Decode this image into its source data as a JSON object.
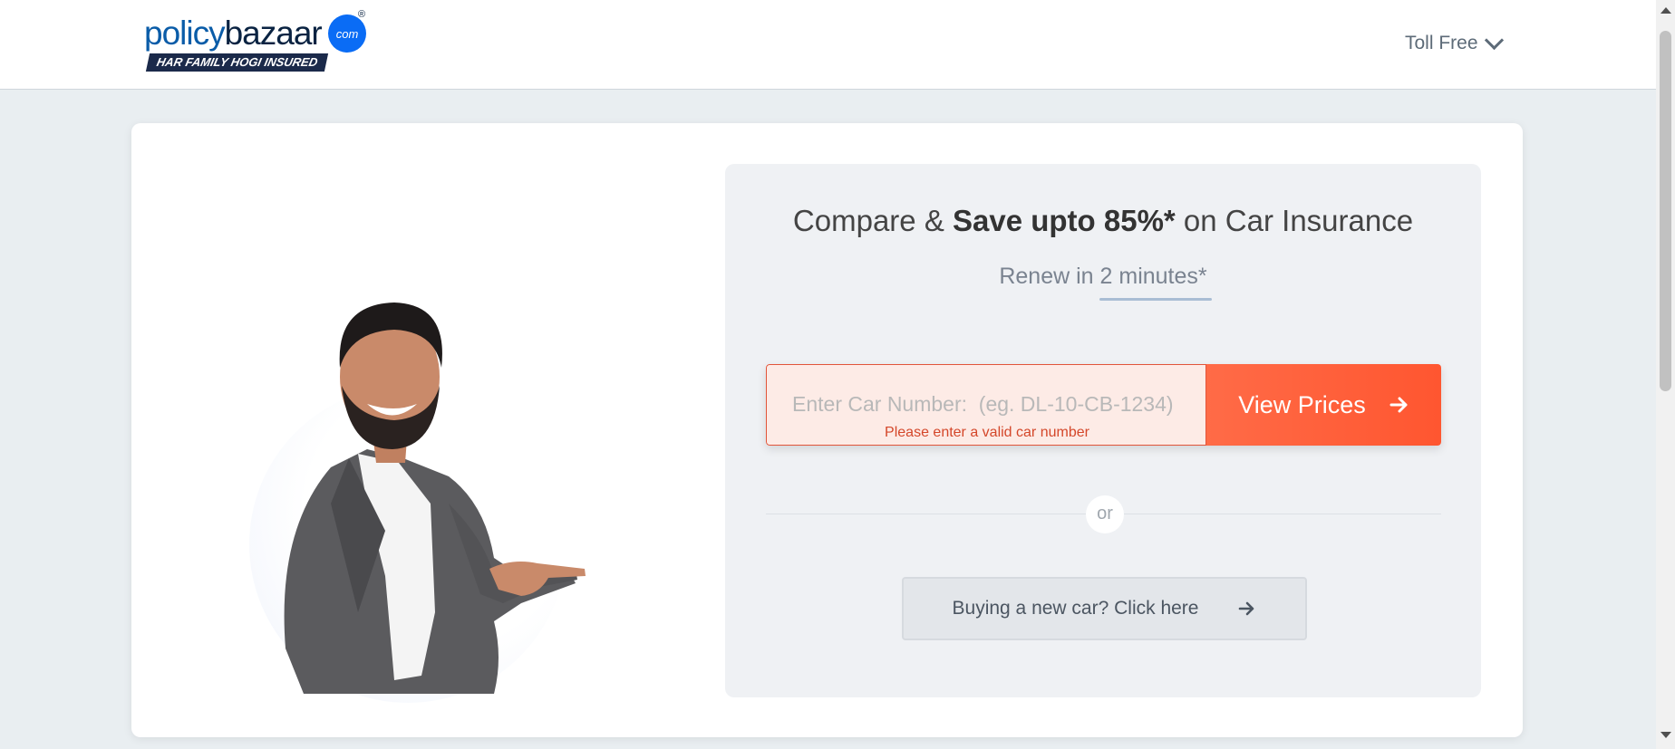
{
  "header": {
    "logo_part1": "policy",
    "logo_part2": "bazaar",
    "logo_com": "com",
    "logo_reg": "®",
    "logo_tagline": "HAR FAMILY HOGI INSURED",
    "toll_free_label": "Toll Free"
  },
  "hero": {
    "headline_pre": "Compare & ",
    "headline_bold": "Save upto 85%*",
    "headline_post": " on Car Insurance",
    "subheadline": "Renew in 2 minutes*"
  },
  "form": {
    "car_number_placeholder": "Enter Car Number:  (eg. DL-10-CB-1234)",
    "car_number_value": "",
    "error_message": "Please enter a valid car number",
    "view_prices_label": "View Prices",
    "or_label": "or",
    "new_car_label": "Buying a new car? Click here"
  },
  "icons": {
    "view_prices_arrow": "arrow-right-icon",
    "new_car_arrow": "arrow-right-icon",
    "toll_free_chevron": "chevron-down-icon"
  },
  "colors": {
    "accent": "#ff5630",
    "brand_blue": "#0a5ca8",
    "error": "#d4472a"
  }
}
